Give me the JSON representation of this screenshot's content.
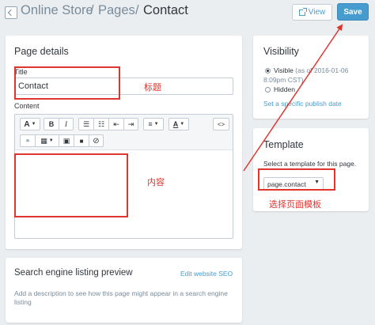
{
  "header": {
    "breadcrumb": [
      "Online Store",
      "/",
      "Pages",
      "/"
    ],
    "page_title": "Contact",
    "view_label": "View",
    "save_label": "Save"
  },
  "page_details": {
    "heading": "Page details",
    "title_label": "Title",
    "title_value": "Contact",
    "content_label": "Content",
    "toolbar": {
      "font_label": "A",
      "bold": "B",
      "italic": "I",
      "color_label": "A",
      "html_toggle": "<>"
    }
  },
  "seo": {
    "heading": "Search engine listing preview",
    "edit_link": "Edit website SEO",
    "description": "Add a description to see how this page might appear in a search engine listing"
  },
  "visibility": {
    "heading": "Visibility",
    "visible_label": "Visible",
    "visible_suffix": "(as of 2016-01-06",
    "visible_time": "8:09pm CST)",
    "hidden_label": "Hidden",
    "publish_link": "Set a specific publish date"
  },
  "template": {
    "heading": "Template",
    "instruction": "Select a template for this page.",
    "selected": "page.contact"
  },
  "annotations": {
    "title_note": "标题",
    "content_note": "内容",
    "template_note": "选择页面模板",
    "color": "#e0352f"
  },
  "colors": {
    "accent": "#479ccf",
    "background": "#ebeef0"
  }
}
